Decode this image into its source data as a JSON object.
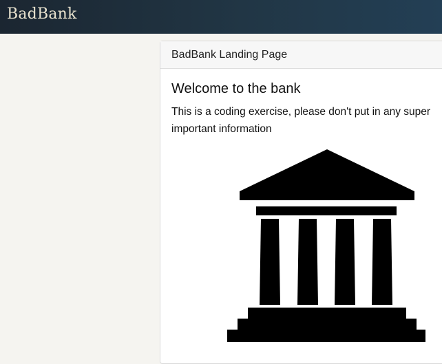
{
  "navbar": {
    "brand": "BadBank"
  },
  "card": {
    "header": "BadBank Landing Page",
    "title": "Welcome to the bank",
    "text": "This is a coding exercise, please don't put in any super important information",
    "image_icon": "bank-building-icon"
  }
}
